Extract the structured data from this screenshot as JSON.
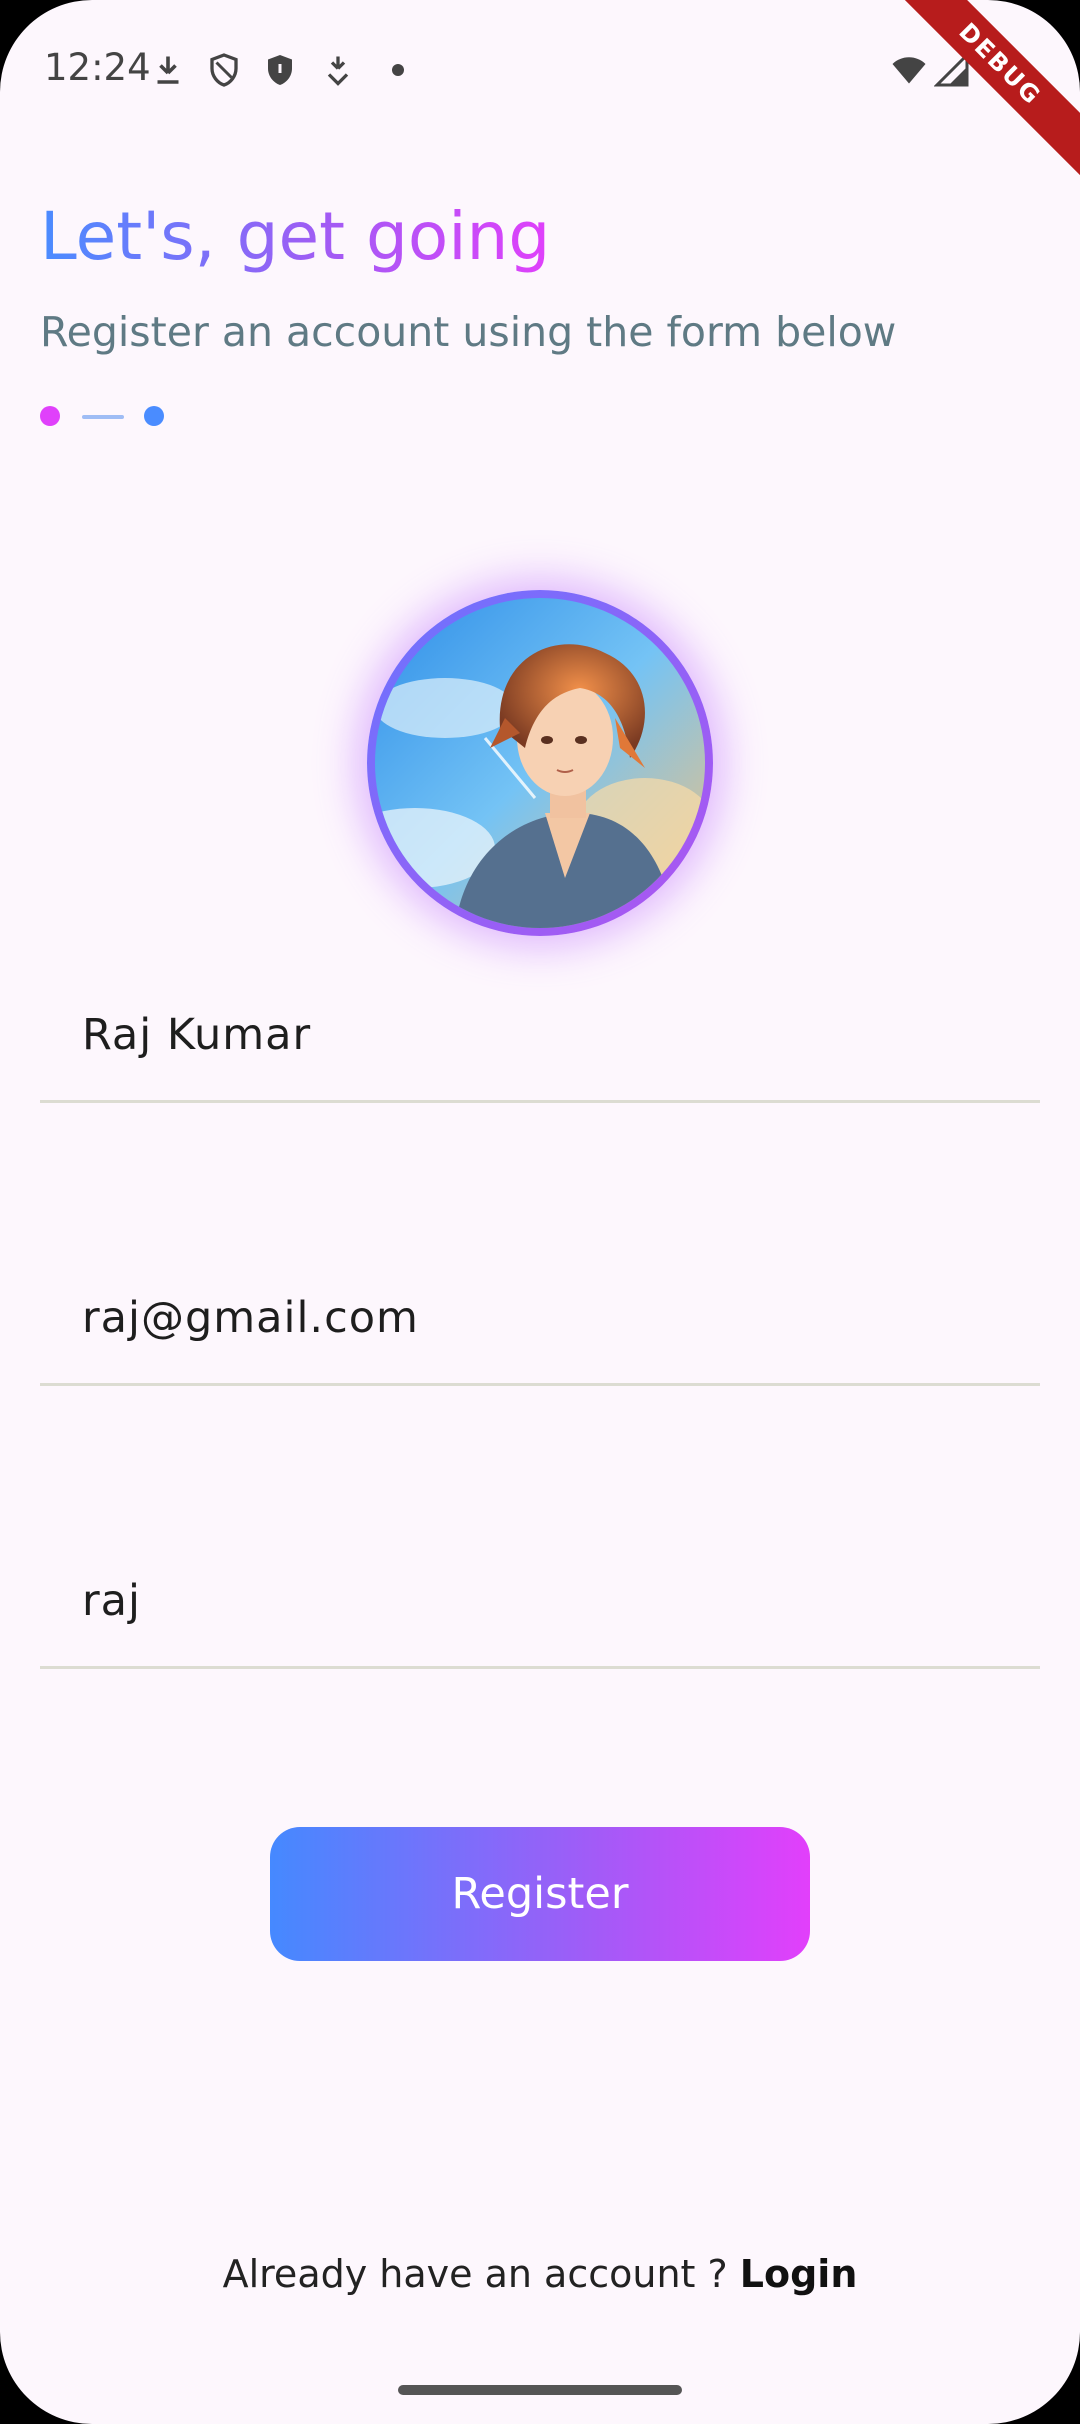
{
  "status_bar": {
    "time": "12:24",
    "debug_label": "DEBUG",
    "left_icons": [
      "download-icon",
      "shield-outline-icon",
      "shield-filled-icon",
      "download-arrow-icon",
      "dot-icon"
    ],
    "right_icons": [
      "wifi-icon",
      "signal-icon",
      "battery-icon"
    ]
  },
  "header": {
    "title": "Let's, get going",
    "subtitle": "Register an account using the form below"
  },
  "steps": {
    "colors": [
      "#e040fb",
      "#4a8cff"
    ]
  },
  "form": {
    "name_value": "Raj Kumar",
    "email_value": "raj@gmail.com",
    "password_value": "raj"
  },
  "actions": {
    "register_label": "Register"
  },
  "footer": {
    "prompt": "Already have an account ? ",
    "login_label": "Login"
  },
  "colors": {
    "background": "#fdf7fd",
    "gradient_start": "#4589ff",
    "gradient_end": "#e23ffb",
    "subtitle": "#5f7a84"
  }
}
